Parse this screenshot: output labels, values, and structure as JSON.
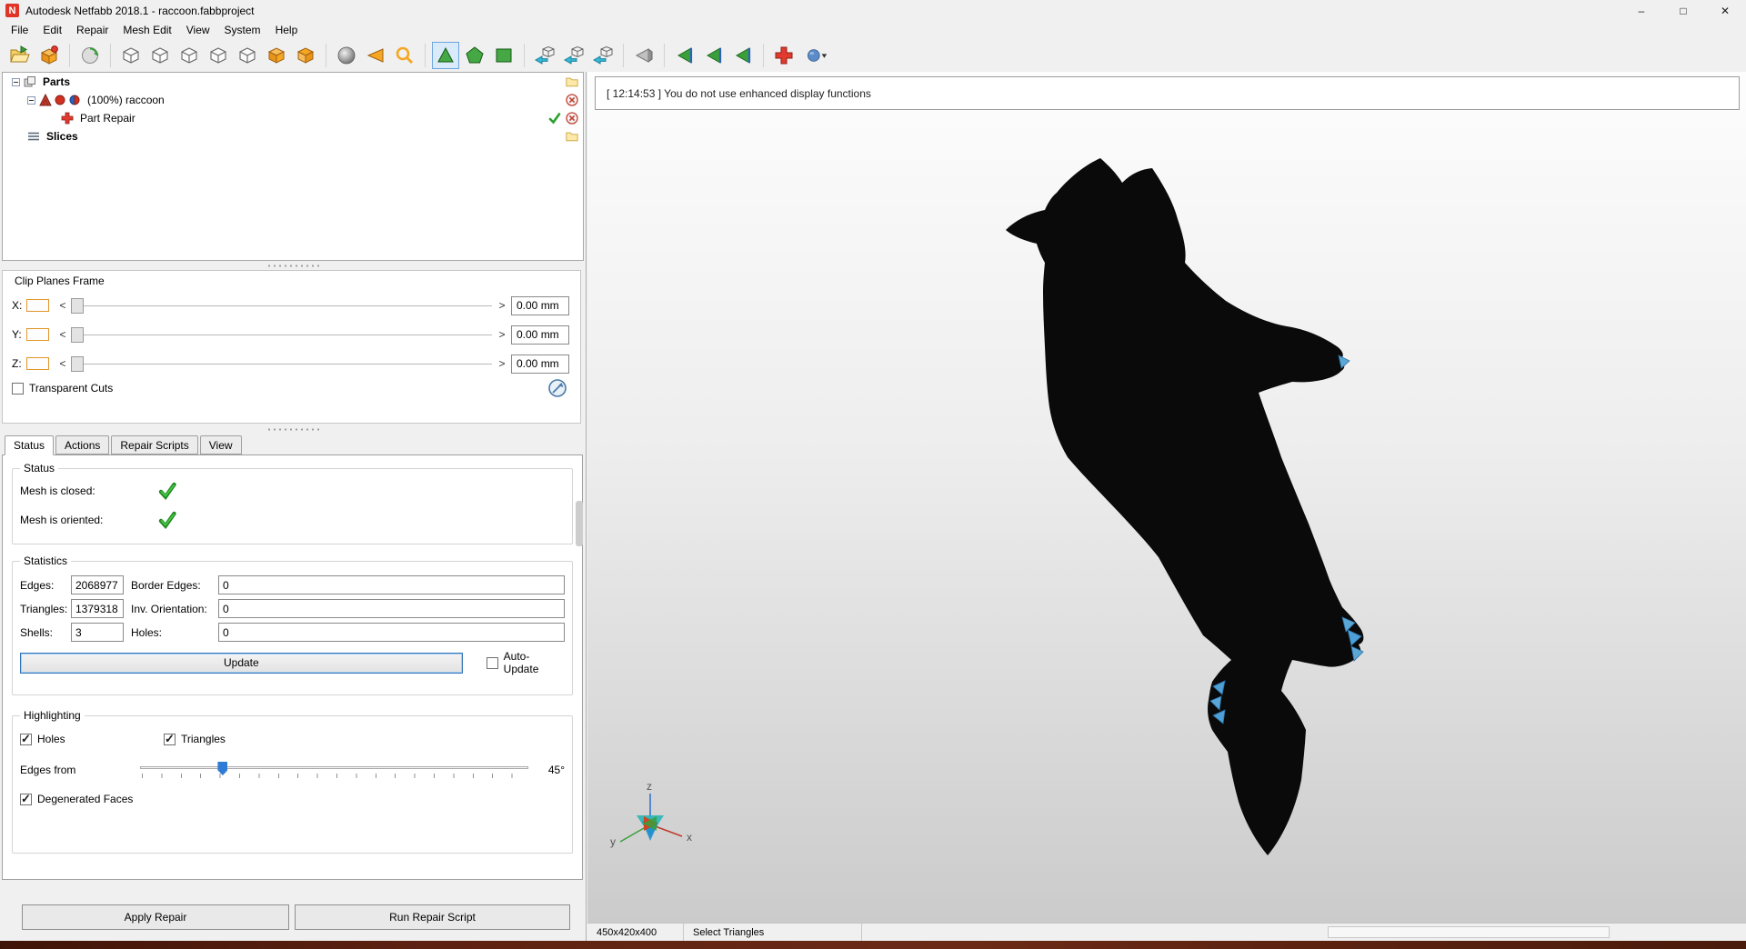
{
  "window": {
    "title": "Autodesk Netfabb 2018.1 - raccoon.fabbproject",
    "controls": {
      "minimize": "–",
      "maximize": "□",
      "close": "✕"
    }
  },
  "menubar": {
    "items": [
      "File",
      "Edit",
      "Repair",
      "Mesh Edit",
      "View",
      "System",
      "Help"
    ]
  },
  "toolbar": {
    "icons": [
      "open-project",
      "add-part",
      "rotate-view",
      "view-front",
      "view-back",
      "view-left",
      "view-right",
      "view-top",
      "view-iso",
      "view-bottom",
      "shaded-view",
      "cone-left",
      "zoom",
      "select-triangles",
      "select-shells",
      "select-surfaces",
      "orient-cube-1",
      "orient-cube-2",
      "orient-cube-3",
      "flip-selection",
      "prev-view-1",
      "prev-view-2",
      "prev-view-3",
      "repair-part",
      "display-mode"
    ],
    "active_icon": "select-triangles"
  },
  "tree": {
    "parts_label": "Parts",
    "raccoon_label": "(100%) raccoon",
    "part_repair_label": "Part Repair",
    "slices_label": "Slices"
  },
  "clip_planes": {
    "title": "Clip Planes Frame",
    "rows": [
      {
        "axis": "X:",
        "value": "0.00 mm"
      },
      {
        "axis": "Y:",
        "value": "0.00 mm"
      },
      {
        "axis": "Z:",
        "value": "0.00 mm"
      }
    ],
    "left_arrow": "<",
    "right_arrow": ">",
    "transparent_cuts_label": "Transparent Cuts"
  },
  "tabs": {
    "items": [
      {
        "label": "Status"
      },
      {
        "label": "Actions"
      },
      {
        "label": "Repair Scripts"
      },
      {
        "label": "View"
      }
    ]
  },
  "status_group": {
    "title": "Status",
    "mesh_closed_label": "Mesh is closed:",
    "mesh_oriented_label": "Mesh is oriented:"
  },
  "statistics": {
    "title": "Statistics",
    "rows": [
      {
        "label_a": "Edges:",
        "value_a": "2068977",
        "label_b": "Border Edges:",
        "value_b": "0"
      },
      {
        "label_a": "Triangles:",
        "value_a": "1379318",
        "label_b": "Inv. Orientation:",
        "value_b": "0"
      },
      {
        "label_a": "Shells:",
        "value_a": "3",
        "label_b": "Holes:",
        "value_b": "0"
      }
    ],
    "update_label": "Update",
    "auto_update_label": "Auto-Update"
  },
  "highlighting": {
    "title": "Highlighting",
    "holes_label": "Holes",
    "triangles_label": "Triangles",
    "edges_from_label": "Edges from",
    "angle_value": "45°",
    "degenerated_label": "Degenerated Faces"
  },
  "footer": {
    "apply_repair_label": "Apply Repair",
    "run_repair_label": "Run Repair Script"
  },
  "viewport": {
    "message": "[ 12:14:53 ] You do not use enhanced display functions",
    "axes": {
      "x": "x",
      "y": "y",
      "z": "z"
    }
  },
  "statusbar": {
    "dimensions": "450x420x400",
    "mode": "Select Triangles"
  },
  "colors": {
    "accent_blue": "#2e7cd6",
    "check_green": "#2ca02c",
    "error_red": "#d4402f",
    "toggle_orange": "#e2962c",
    "model_black": "#0a0a0a"
  }
}
